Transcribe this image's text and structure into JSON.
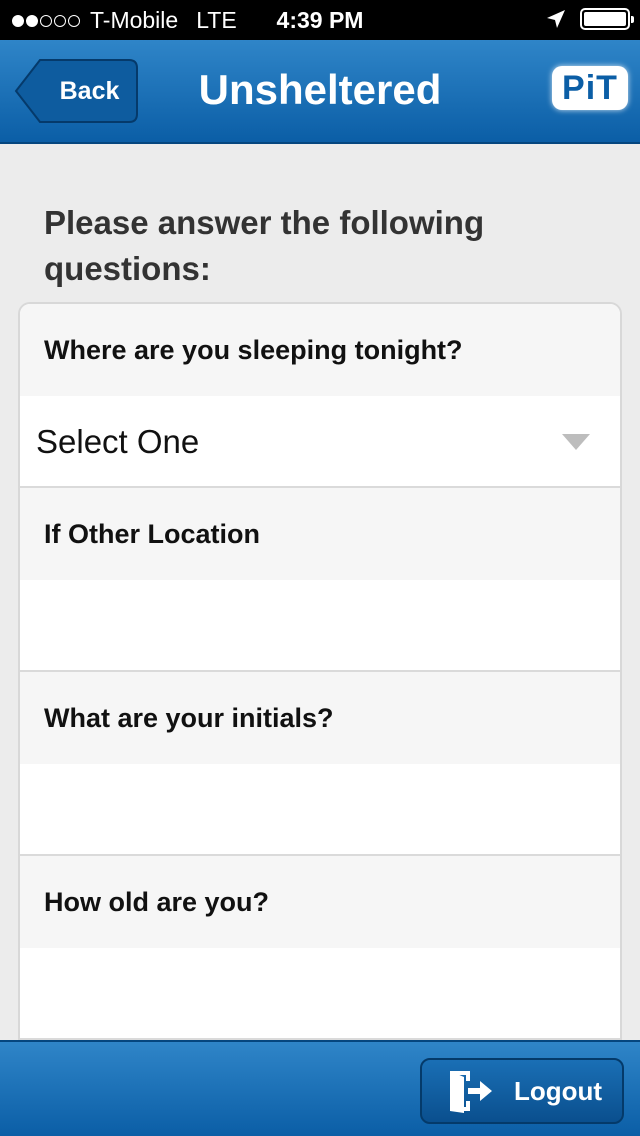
{
  "status_bar": {
    "carrier": "T-Mobile",
    "network": "LTE",
    "time": "4:39 PM",
    "signal_bars_filled": 2,
    "signal_bars_total": 5
  },
  "header": {
    "back_label": "Back",
    "title": "Unsheltered",
    "logo_text": "PiT",
    "color": "#1a6fb5"
  },
  "content": {
    "prompt": "Please answer the following questions:",
    "questions": [
      {
        "label": "Where are you sleeping tonight?",
        "value": "Select One",
        "type": "select"
      },
      {
        "label": "If Other Location",
        "value": "",
        "type": "text"
      },
      {
        "label": "What are your initials?",
        "value": "",
        "type": "text"
      },
      {
        "label": "How old are you?",
        "value": "",
        "type": "text"
      }
    ]
  },
  "footer": {
    "logout_label": "Logout",
    "logout_icon": "logout-door-icon"
  }
}
